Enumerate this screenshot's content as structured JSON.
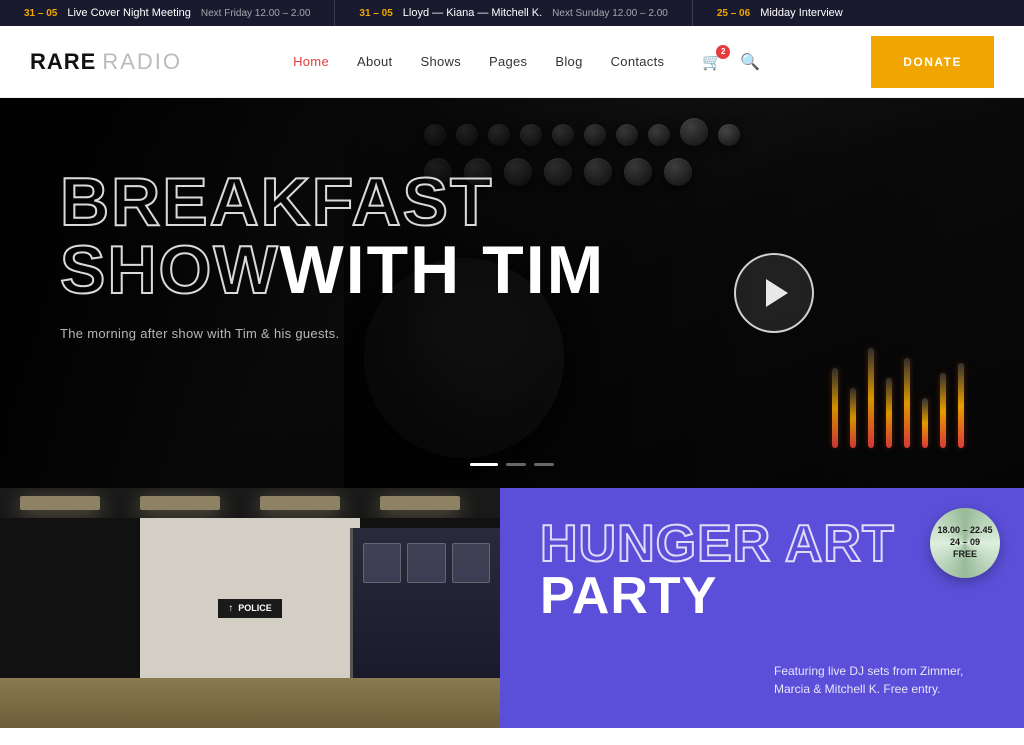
{
  "ticker": {
    "items": [
      {
        "date": "31 – 05",
        "title": "Live Cover Night Meeting",
        "time": "Next Friday 12.00 – 2.00"
      },
      {
        "date": "31 – 05",
        "title": "Lloyd — Kiana — Mitchell K.",
        "time": "Next Sunday 12.00 – 2.00"
      },
      {
        "date": "25 – 06",
        "title": "Midday Interview",
        "time": ""
      }
    ]
  },
  "header": {
    "logo_bold": "RARE",
    "logo_light": "RADIO",
    "nav": [
      {
        "label": "Home",
        "active": true
      },
      {
        "label": "About",
        "active": false
      },
      {
        "label": "Shows",
        "active": false
      },
      {
        "label": "Pages",
        "active": false
      },
      {
        "label": "Blog",
        "active": false
      },
      {
        "label": "Contacts",
        "active": false
      }
    ],
    "cart_count": "2",
    "donate_label": "DONATE"
  },
  "hero": {
    "title_line1_outline": "BREAKFAST",
    "title_line2_part1_solid_before": "SHOW ",
    "title_line2_part2_outline": "WITH TIM",
    "subtitle": "The morning after show with Tim & his guests.",
    "slide_count": 3,
    "active_slide": 0
  },
  "event": {
    "badge_time": "18.00 – 22.45",
    "badge_date": "24 – 09",
    "badge_price": "FREE",
    "title_line1": "HUNGER ART",
    "title_line2": "PARTY",
    "description": "Featuring live DJ sets from Zimmer, Marcia & Mitchell K. Free entry."
  }
}
